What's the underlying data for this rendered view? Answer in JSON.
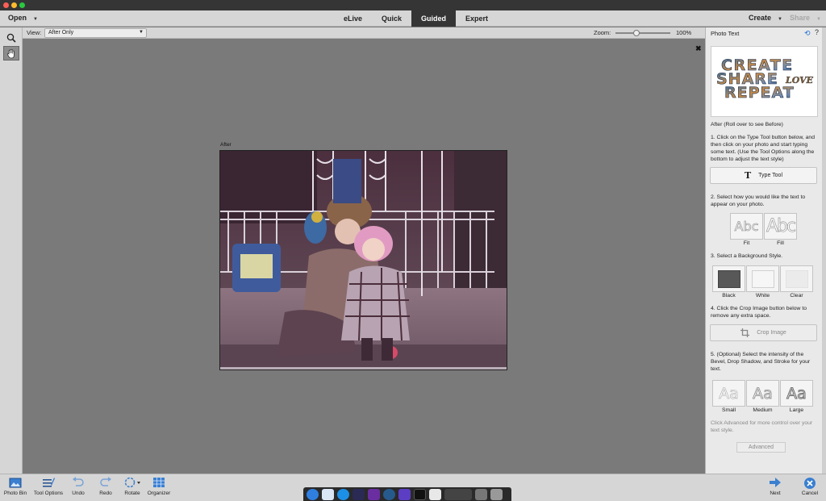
{
  "topbar": {
    "open_label": "Open",
    "modes": [
      "eLive",
      "Quick",
      "Guided",
      "Expert"
    ],
    "active_mode": "Guided",
    "create_label": "Create",
    "share_label": "Share"
  },
  "options": {
    "view_label": "View:",
    "view_value": "After Only",
    "zoom_label": "Zoom:",
    "zoom_value": "100%",
    "zoom_fraction": 0.38
  },
  "canvas": {
    "after_label": "After"
  },
  "panel": {
    "title": "Photo Text",
    "preview_words": [
      "CREATE",
      "SHARE",
      "LOVE",
      "REPEAT"
    ],
    "roll_over": "After (Roll over to see Before)",
    "step1": "1. Click on the Type Tool button below, and then click on your photo and start typing some text. (Use the Tool Options along the bottom to adjust the text style)",
    "type_tool_label": "Type Tool",
    "type_tool_glyph": "T",
    "step2": "2. Select how you would like the text to appear on your photo.",
    "fit_options": [
      {
        "label": "Fit",
        "glyph": "Abc"
      },
      {
        "label": "Fill",
        "glyph": "Abc"
      }
    ],
    "step3": "3. Select a Background Style.",
    "bg_options": [
      {
        "label": "Black",
        "color": "#585858"
      },
      {
        "label": "White",
        "color": "#f6f6f6"
      },
      {
        "label": "Clear",
        "color": "#ebebeb"
      }
    ],
    "step4": "4. Click the Crop Image button below to remove any extra space.",
    "crop_label": "Crop Image",
    "step5": "5. (Optional) Select the intensity of the Bevel, Drop Shadow, and Stroke for your text.",
    "intensity_options": [
      {
        "label": "Small",
        "glyph": "Aa"
      },
      {
        "label": "Medium",
        "glyph": "Aa"
      },
      {
        "label": "Large",
        "glyph": "Aa"
      }
    ],
    "advanced_note": "Click Advanced for more control over your text style.",
    "advanced_label": "Advanced"
  },
  "bottombar": {
    "photo_bin": "Photo Bin",
    "tool_options": "Tool Options",
    "undo": "Undo",
    "redo": "Redo",
    "rotate": "Rotate",
    "organizer": "Organizer",
    "next": "Next",
    "cancel": "Cancel"
  },
  "colors": {
    "accent_blue": "#1f6fd0",
    "active_mode_bg": "#353535",
    "canvas_bg": "#7a7a7a"
  }
}
